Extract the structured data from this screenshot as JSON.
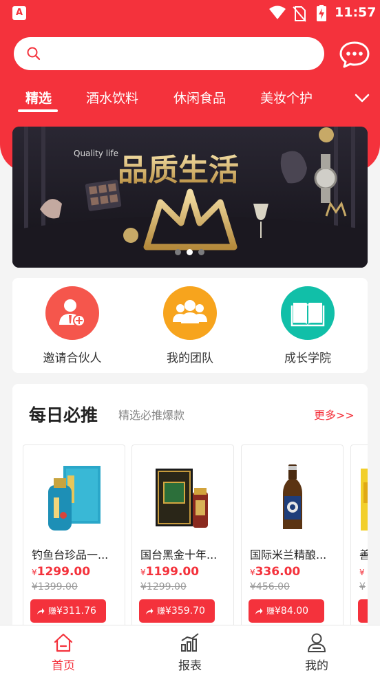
{
  "status_bar": {
    "time": "11:57",
    "app_badge": "A"
  },
  "search": {
    "value": "",
    "placeholder": ""
  },
  "category_tabs": [
    {
      "label": "精选",
      "active": true
    },
    {
      "label": "酒水饮料",
      "active": false
    },
    {
      "label": "休闲食品",
      "active": false
    },
    {
      "label": "美妆个护",
      "active": false
    }
  ],
  "banner": {
    "subtitle": "Quality life",
    "title": "品质生活",
    "page_count": 3,
    "active_page": 2
  },
  "quick_actions": [
    {
      "label": "邀请合伙人",
      "icon": "add-user-icon",
      "color": "#f5564c"
    },
    {
      "label": "我的团队",
      "icon": "team-icon",
      "color": "#f7a41d"
    },
    {
      "label": "成长学院",
      "icon": "book-icon",
      "color": "#11bfa8"
    }
  ],
  "daily": {
    "title": "每日必推",
    "subtitle": "精选必推爆款",
    "more": "更多>>"
  },
  "products": [
    {
      "name": "钓鱼台珍品一...",
      "price": "1299.00",
      "original_price": "¥1399.00",
      "earn_label": "赚",
      "earn_amount": "¥311.76",
      "image": "blue-liquor-bottle-box"
    },
    {
      "name": "国台黑金十年...",
      "price": "1199.00",
      "original_price": "¥1299.00",
      "earn_label": "赚",
      "earn_amount": "¥359.70",
      "image": "black-gold-liquor-box"
    },
    {
      "name": "国际米兰精酿...",
      "price": "336.00",
      "original_price": "¥456.00",
      "earn_label": "赚",
      "earn_amount": "¥84.00",
      "image": "craft-beer-bottle"
    },
    {
      "name": "善",
      "price": "",
      "original_price": "¥",
      "earn_label": "",
      "earn_amount": "",
      "image": "yellow-product"
    }
  ],
  "currency_symbol": "¥",
  "bottom_nav": [
    {
      "label": "首页",
      "icon": "home-icon",
      "active": true
    },
    {
      "label": "报表",
      "icon": "report-chart-icon",
      "active": false
    },
    {
      "label": "我的",
      "icon": "profile-icon",
      "active": false
    }
  ],
  "colors": {
    "brand_red": "#f4323c",
    "page_bg": "#f4f4f4"
  }
}
